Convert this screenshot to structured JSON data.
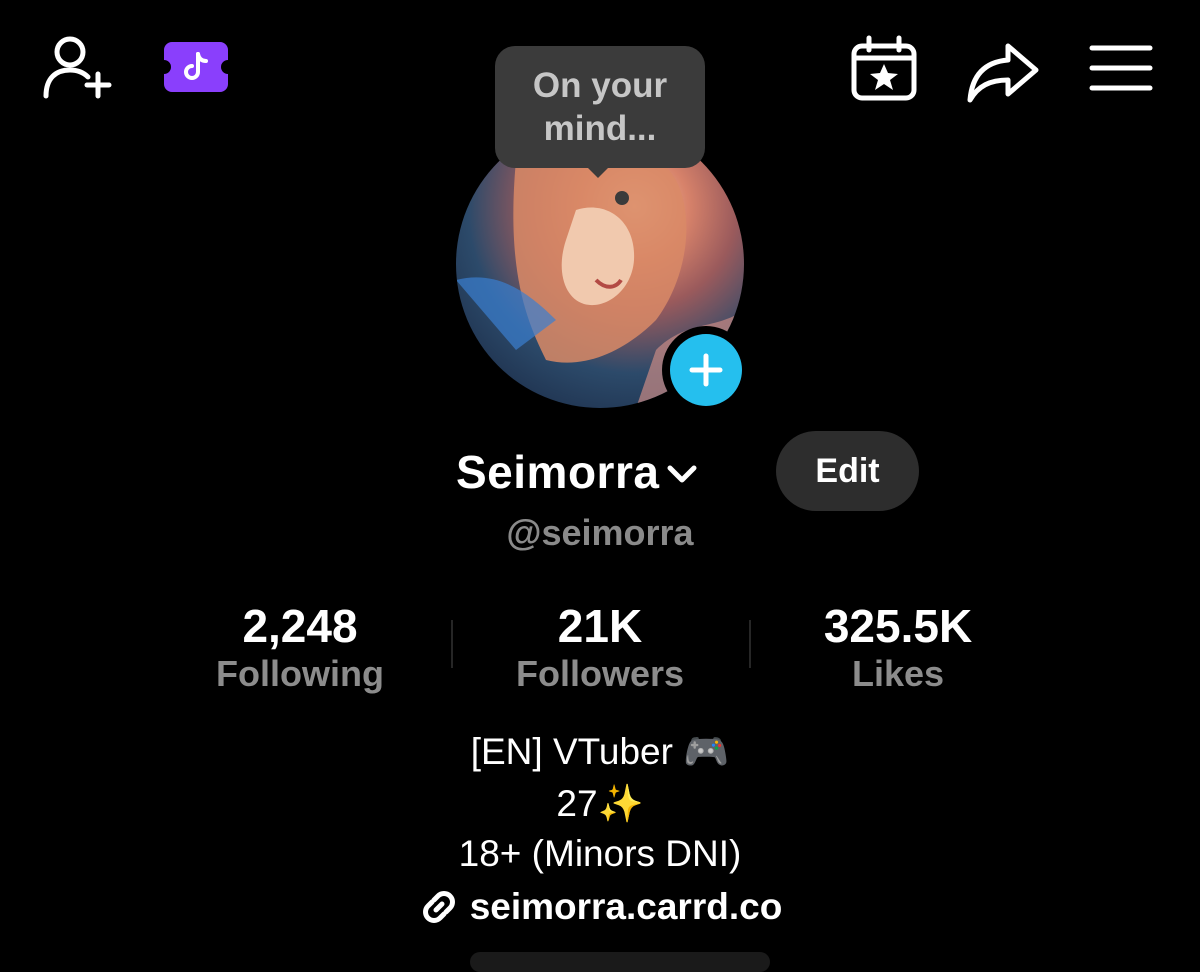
{
  "topbar": {
    "icons": [
      "add-friend-icon",
      "tiktok-ticket-icon",
      "calendar-star-icon",
      "share-icon",
      "menu-icon"
    ],
    "accent_ticket": "#8a3ffc"
  },
  "bubble": {
    "text": "On your mind..."
  },
  "profile": {
    "display_name": "Seimorra",
    "username": "@seimorra",
    "edit_label": "Edit",
    "add_story_color": "#25bfee"
  },
  "stats": [
    {
      "value": "2,248",
      "label": "Following"
    },
    {
      "value": "21K",
      "label": "Followers"
    },
    {
      "value": "325.5K",
      "label": "Likes"
    }
  ],
  "bio": {
    "line1": "[EN] VTuber 🎮",
    "line2": "27✨",
    "line3": "18+ (Minors DNI)",
    "link": "seimorra.carrd.co"
  }
}
